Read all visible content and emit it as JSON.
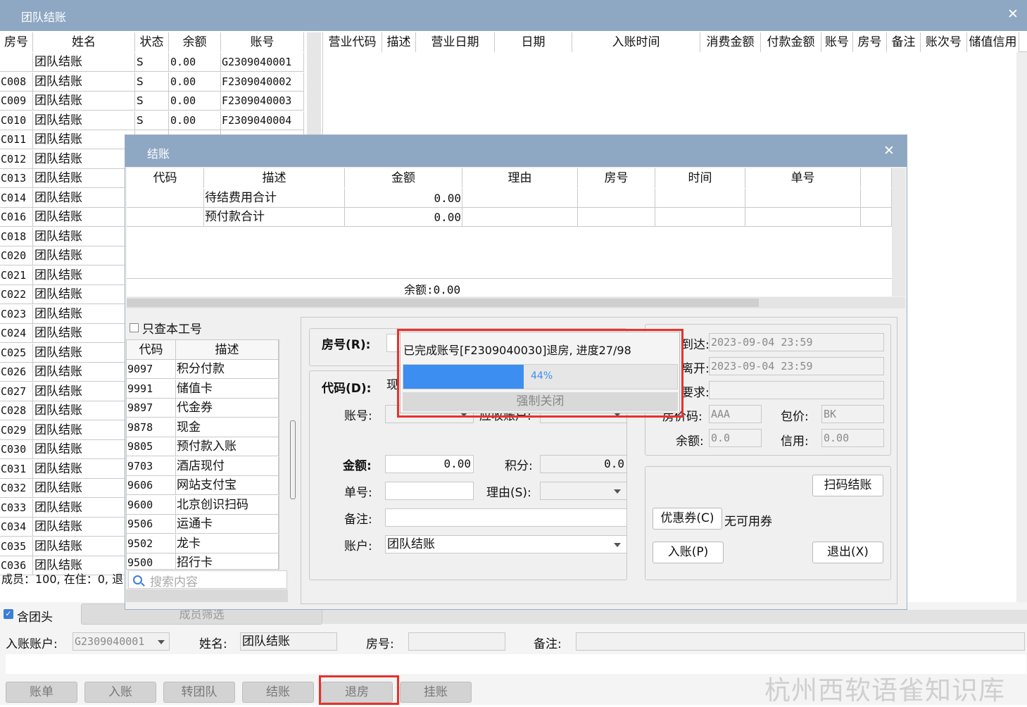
{
  "main_window": {
    "title": "团队结账",
    "close": "✕"
  },
  "left_table": {
    "headers": [
      "房号",
      "姓名",
      "状态",
      "余额",
      "账号"
    ],
    "rows": [
      [
        "",
        "团队结账",
        "S",
        "0.00",
        "G2309040001"
      ],
      [
        "C008",
        "团队结账",
        "S",
        "0.00",
        "F2309040002"
      ],
      [
        "C009",
        "团队结账",
        "S",
        "0.00",
        "F2309040003"
      ],
      [
        "C010",
        "团队结账",
        "S",
        "0.00",
        "F2309040004"
      ],
      [
        "C011",
        "团队结账",
        "",
        "",
        ""
      ],
      [
        "C012",
        "团队结账",
        "",
        "",
        ""
      ],
      [
        "C013",
        "团队结账",
        "",
        "",
        ""
      ],
      [
        "C014",
        "团队结账",
        "",
        "",
        ""
      ],
      [
        "C016",
        "团队结账",
        "",
        "",
        ""
      ],
      [
        "C018",
        "团队结账",
        "",
        "",
        ""
      ],
      [
        "C020",
        "团队结账",
        "",
        "",
        ""
      ],
      [
        "C021",
        "团队结账",
        "",
        "",
        ""
      ],
      [
        "C022",
        "团队结账",
        "",
        "",
        ""
      ],
      [
        "C023",
        "团队结账",
        "",
        "",
        ""
      ],
      [
        "C024",
        "团队结账",
        "",
        "",
        ""
      ],
      [
        "C025",
        "团队结账",
        "",
        "",
        ""
      ],
      [
        "C026",
        "团队结账",
        "",
        "",
        ""
      ],
      [
        "C027",
        "团队结账",
        "",
        "",
        ""
      ],
      [
        "C028",
        "团队结账",
        "",
        "",
        ""
      ],
      [
        "C029",
        "团队结账",
        "",
        "",
        ""
      ],
      [
        "C030",
        "团队结账",
        "",
        "",
        ""
      ],
      [
        "C031",
        "团队结账",
        "",
        "",
        ""
      ],
      [
        "C032",
        "团队结账",
        "",
        "",
        ""
      ],
      [
        "C033",
        "团队结账",
        "",
        "",
        ""
      ],
      [
        "C034",
        "团队结账",
        "",
        "",
        ""
      ],
      [
        "C035",
        "团队结账",
        "",
        "",
        ""
      ],
      [
        "C036",
        "团队结账",
        "",
        "",
        ""
      ]
    ],
    "summary": "成员：100, 在住：0, 退"
  },
  "right_table": {
    "headers": [
      "营业代码",
      "描述",
      "营业日期",
      "日期",
      "入账时间",
      "消费金额",
      "付款金额",
      "账号",
      "房号",
      "备注",
      "账次号",
      "储值信用"
    ]
  },
  "bottom": {
    "include_head_label": "含团头",
    "member_filter": "成员筛选",
    "account_label": "入账账户:",
    "account_value": "G2309040001",
    "name_label": "姓名:",
    "name_value": "团队结账",
    "room_label": "房号:",
    "room_value": "",
    "note_label": "备注:",
    "note_value": "",
    "buttons": [
      "账单",
      "入账",
      "转团队",
      "结账",
      "退房",
      "挂账"
    ],
    "watermark": "杭州西软语雀知识库"
  },
  "checkout_dialog": {
    "title": "结账",
    "close": "✕",
    "table_headers": [
      "代码",
      "描述",
      "金额",
      "理由",
      "房号",
      "时间",
      "单号"
    ],
    "table_rows": [
      [
        "",
        "待结费用合计",
        "0.00",
        "",
        "",
        "",
        ""
      ],
      [
        "",
        "预付款合计",
        "0.00",
        "",
        "",
        "",
        ""
      ]
    ],
    "balance_text": "余额:0.00",
    "only_my_shift": "只查本工号",
    "code_list_headers": [
      "代码",
      "描述"
    ],
    "code_list": [
      [
        "9097",
        "积分付款"
      ],
      [
        "9991",
        "储值卡"
      ],
      [
        "9897",
        "代金券"
      ],
      [
        "9878",
        "现金"
      ],
      [
        "9805",
        "预付款入账"
      ],
      [
        "9703",
        "酒店现付"
      ],
      [
        "9606",
        "网站支付宝"
      ],
      [
        "9600",
        "北京创识扫码"
      ],
      [
        "9506",
        "运通卡"
      ],
      [
        "9502",
        "龙卡"
      ],
      [
        "9500",
        "招行卡"
      ]
    ],
    "search_placeholder": "搜索内容",
    "form": {
      "room_label": "房号(R):",
      "code_label": "代码(D):",
      "code_value": "现",
      "account_no_label": "账号:",
      "receivable_label": "应收账户:",
      "amount_label": "金额:",
      "amount_value": "0.00",
      "points_label": "积分:",
      "points_value": "0.0",
      "bill_no_label": "单号:",
      "reason_label": "理由(S):",
      "remark_label": "备注:",
      "account_label": "账户:",
      "account_value": "团队结账"
    },
    "info": {
      "arrive_label": "到达:",
      "arrive_value": "2023-09-04 23:59",
      "depart_label": "离开:",
      "depart_value": "2023-09-04 23:59",
      "require_label": "要求:",
      "require_value": "",
      "rate_code_label": "房价码:",
      "rate_code_value": "AAA",
      "package_label": "包价:",
      "package_value": "BK",
      "balance_label": "余额:",
      "balance_value": "0.0",
      "credit_label": "信用:",
      "credit_value": "0.00"
    },
    "buttons": {
      "scan": "扫码结账",
      "coupon": "优惠券(C)",
      "no_coupon": "无可用券",
      "post": "入账(P)",
      "exit": "退出(X)"
    }
  },
  "progress_popup": {
    "message": "已完成账号[F2309040030]退房, 进度27/98",
    "percent": 44,
    "percent_label": "44%",
    "force_close": "强制关闭"
  },
  "colors": {
    "titlebar": "#8ea7c3",
    "progress": "#3c8ef0",
    "highlight": "#e8312a"
  }
}
